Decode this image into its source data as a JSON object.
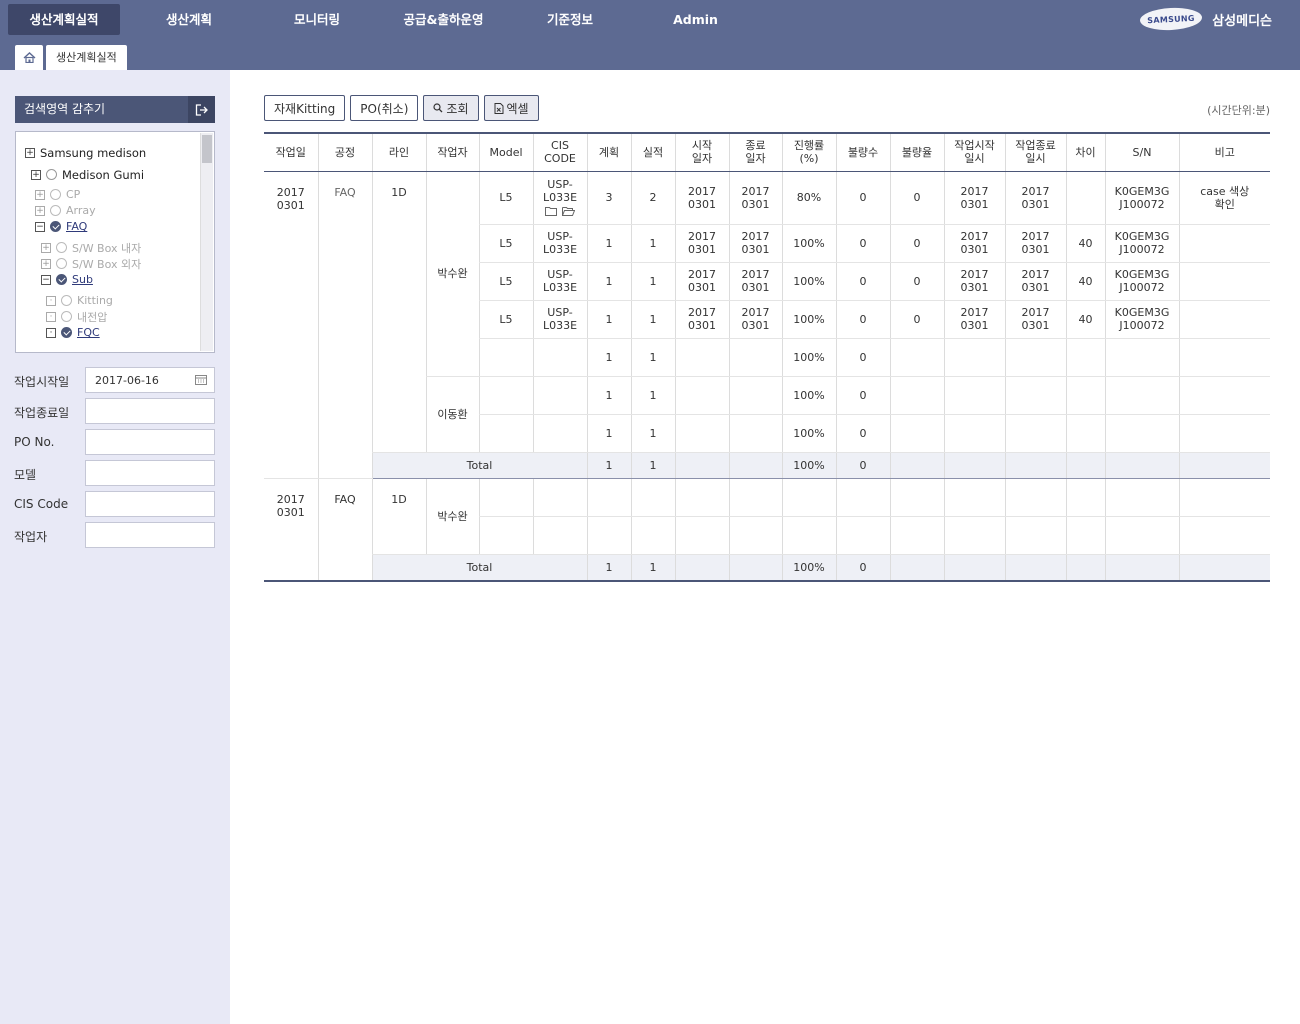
{
  "nav": {
    "items": [
      "생산계획실적",
      "생산계획",
      "모니터링",
      "공급&출하운영",
      "기준정보",
      "Admin"
    ],
    "active_index": 0
  },
  "brand": {
    "logo_text": "SAMSUNG",
    "name": "삼성메디슨"
  },
  "tabs": {
    "current": "생산계획실적"
  },
  "sidebar": {
    "collapse_label": "검색영역 감추기",
    "tree": [
      {
        "label": "Samsung medison"
      },
      {
        "label": "Medison Gumi"
      },
      {
        "label": "CP"
      },
      {
        "label": "Array"
      },
      {
        "label": "FAQ"
      },
      {
        "label": "S/W Box 내자"
      },
      {
        "label": "S/W Box 외자"
      },
      {
        "label": "Sub"
      },
      {
        "label": "Kitting"
      },
      {
        "label": "내전압"
      },
      {
        "label": "FQC"
      }
    ],
    "form": {
      "start_date_label": "작업시작일",
      "start_date_value": "2017-06-16",
      "end_date_label": "작업종료일",
      "end_date_value": "",
      "po_label": "PO No.",
      "po_value": "",
      "model_label": "모델",
      "model_value": "",
      "cis_label": "CIS Code",
      "cis_value": "",
      "worker_label": "작업자",
      "worker_value": ""
    }
  },
  "toolbar": {
    "kitting_label": "자재Kitting",
    "po_cancel_label": "PO(취소)",
    "search_label": "조회",
    "excel_label": "엑셀"
  },
  "time_unit": "(시간단위:분)",
  "table": {
    "headers": {
      "work_date": "작업일",
      "process": "공정",
      "line": "라인",
      "worker": "작업자",
      "model": "Model",
      "cis_code": "CIS\nCODE",
      "plan": "계획",
      "actual": "실적",
      "start": "시작\n일자",
      "end": "종료\n일자",
      "progress": "진행률\n(%)",
      "defect_count": "불량수",
      "defect_rate": "불량율",
      "work_start": "작업시작\n일시",
      "work_end": "작업종료\n일시",
      "diff": "차이",
      "sn": "S/N",
      "note": "비고"
    },
    "group1": {
      "work_date": "2017\n0301",
      "process": "FAQ",
      "line": "1D",
      "worker_a": "박수완",
      "worker_b": "이동환",
      "rows": [
        {
          "model": "L5",
          "cis": "USP-\nL033E",
          "plan": "3",
          "actual": "2",
          "start": "2017\n0301",
          "end": "2017\n0301",
          "progress": "80%",
          "defect_count": "0",
          "defect_rate": "0",
          "work_start": "2017\n0301",
          "work_end": "2017\n0301",
          "diff": "",
          "sn": "K0GEM3G\nJ100072",
          "note": "case 색상\n확인"
        },
        {
          "model": "L5",
          "cis": "USP-\nL033E",
          "plan": "1",
          "actual": "1",
          "start": "2017\n0301",
          "end": "2017\n0301",
          "progress": "100%",
          "defect_count": "0",
          "defect_rate": "0",
          "work_start": "2017\n0301",
          "work_end": "2017\n0301",
          "diff": "40",
          "sn": "K0GEM3G\nJ100072",
          "note": ""
        },
        {
          "model": "L5",
          "cis": "USP-\nL033E",
          "plan": "1",
          "actual": "1",
          "start": "2017\n0301",
          "end": "2017\n0301",
          "progress": "100%",
          "defect_count": "0",
          "defect_rate": "0",
          "work_start": "2017\n0301",
          "work_end": "2017\n0301",
          "diff": "40",
          "sn": "K0GEM3G\nJ100072",
          "note": ""
        },
        {
          "model": "L5",
          "cis": "USP-\nL033E",
          "plan": "1",
          "actual": "1",
          "start": "2017\n0301",
          "end": "2017\n0301",
          "progress": "100%",
          "defect_count": "0",
          "defect_rate": "0",
          "work_start": "2017\n0301",
          "work_end": "2017\n0301",
          "diff": "40",
          "sn": "K0GEM3G\nJ100072",
          "note": ""
        },
        {
          "model": "",
          "cis": "",
          "plan": "1",
          "actual": "1",
          "start": "",
          "end": "",
          "progress": "100%",
          "defect_count": "0",
          "defect_rate": "",
          "work_start": "",
          "work_end": "",
          "diff": "",
          "sn": "",
          "note": ""
        },
        {
          "model": "",
          "cis": "",
          "plan": "1",
          "actual": "1",
          "start": "",
          "end": "",
          "progress": "100%",
          "defect_count": "0",
          "defect_rate": "",
          "work_start": "",
          "work_end": "",
          "diff": "",
          "sn": "",
          "note": ""
        },
        {
          "model": "",
          "cis": "",
          "plan": "1",
          "actual": "1",
          "start": "",
          "end": "",
          "progress": "100%",
          "defect_count": "0",
          "defect_rate": "",
          "work_start": "",
          "work_end": "",
          "diff": "",
          "sn": "",
          "note": ""
        }
      ],
      "total": {
        "label": "Total",
        "plan": "1",
        "actual": "1",
        "progress": "100%",
        "defect_count": "0"
      }
    },
    "group2": {
      "work_date": "2017\n0301",
      "process": "FAQ",
      "line": "1D",
      "worker": "박수완",
      "total": {
        "label": "Total",
        "plan": "1",
        "actual": "1",
        "progress": "100%",
        "defect_count": "0"
      }
    }
  },
  "colors": {
    "header_bg": "#5d6a92",
    "nav_active": "#3e4769",
    "sidebar_bg": "#e8e9f6",
    "accent": "#4b5677",
    "total_row_bg": "#eef0f6"
  }
}
